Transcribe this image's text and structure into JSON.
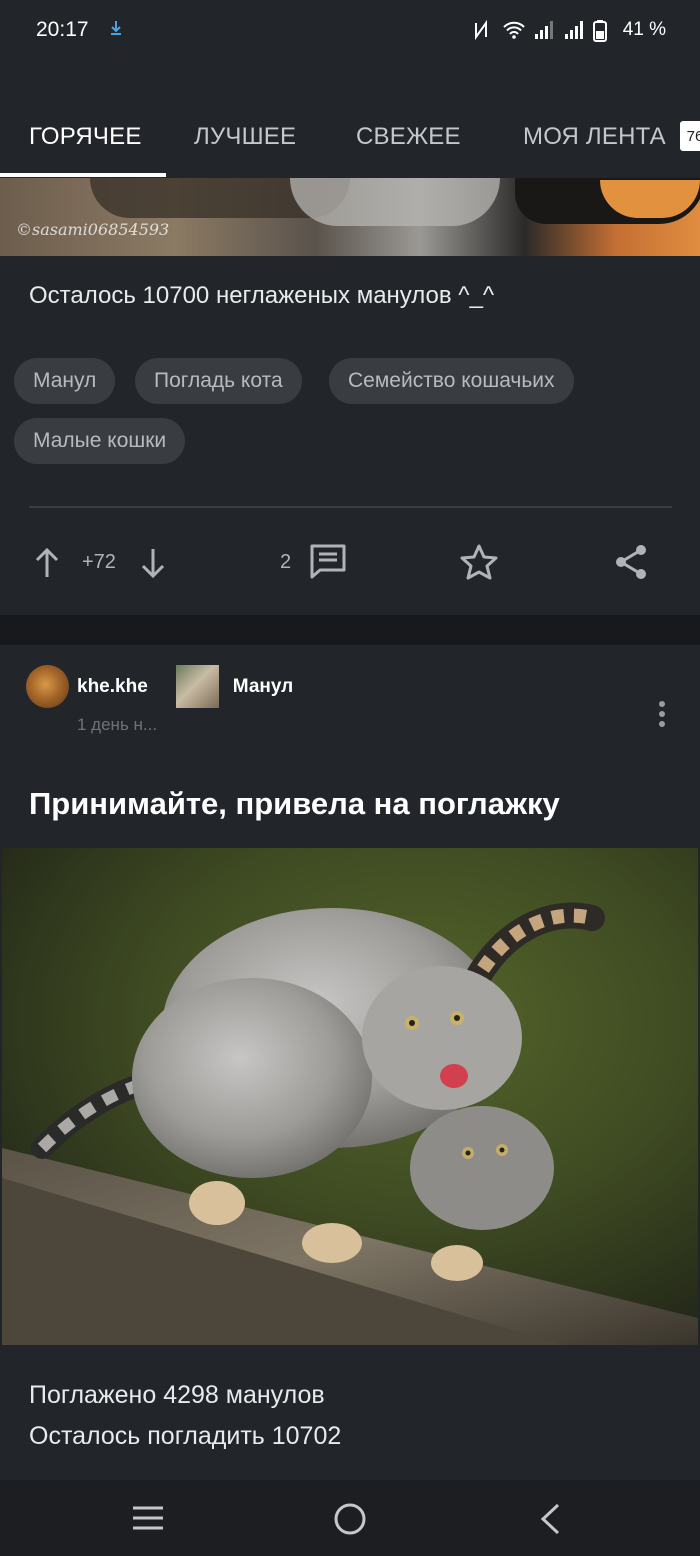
{
  "status_bar": {
    "time": "20:17",
    "battery": "41 %",
    "icons": [
      "download-icon",
      "nfc-icon",
      "wifi-icon",
      "signal-icon",
      "signal-icon",
      "battery-icon"
    ]
  },
  "tabs": {
    "items": [
      {
        "label": "ГОРЯЧЕЕ",
        "active": true
      },
      {
        "label": "ЛУЧШЕЕ",
        "active": false
      },
      {
        "label": "СВЕЖЕЕ",
        "active": false
      },
      {
        "label": "МОЯ ЛЕНТА",
        "active": false
      }
    ],
    "badge": "76"
  },
  "post1": {
    "image_watermark": "©sasami06854593",
    "text": "Осталось 10700 неглаженых манулов ^_^",
    "tags": [
      "Манул",
      "Погладь кота",
      "Семейство кошачьих",
      "Малые кошки"
    ],
    "rating": "+72",
    "comments": "2"
  },
  "post2": {
    "author": "khe.khe",
    "community": "Манул",
    "time": "1 день н...",
    "title": "Принимайте, привела на поглажку",
    "body_line1": "Поглажено 4298 манулов",
    "body_line2": "Осталось погладить 10702"
  },
  "colors": {
    "background": "#1a1c1f",
    "card": "#22262b",
    "tag_bg": "#393d42",
    "accent_download": "#4aa3df"
  }
}
